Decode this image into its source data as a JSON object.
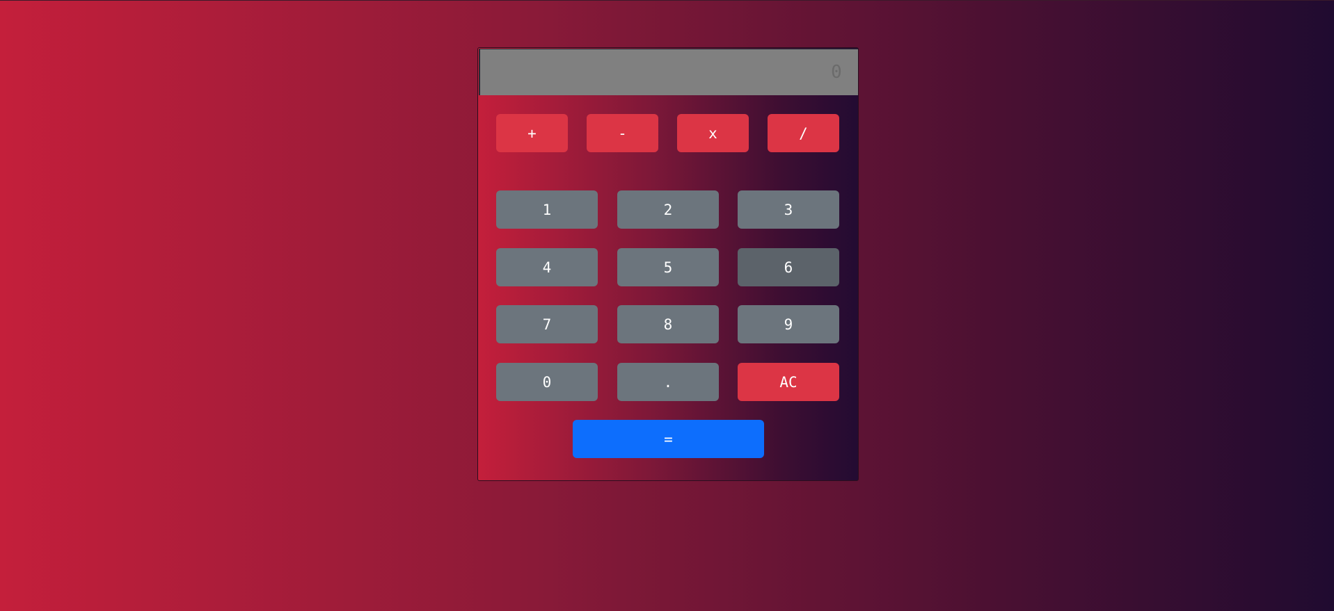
{
  "display": {
    "value": "0"
  },
  "operators": [
    {
      "label": "+"
    },
    {
      "label": "-"
    },
    {
      "label": "x"
    },
    {
      "label": "/"
    }
  ],
  "digits": {
    "one": "1",
    "two": "2",
    "three": "3",
    "four": "4",
    "five": "5",
    "six": "6",
    "seven": "7",
    "eight": "8",
    "nine": "9",
    "zero": "0",
    "decimal": "."
  },
  "clear_label": "AC",
  "equals_label": "=",
  "colors": {
    "operator": "#dc3545",
    "digit": "#6c757d",
    "digit_hover": "#5c636a",
    "clear": "#dc3545",
    "equals": "#0d6efd",
    "display_bg": "#808080"
  }
}
